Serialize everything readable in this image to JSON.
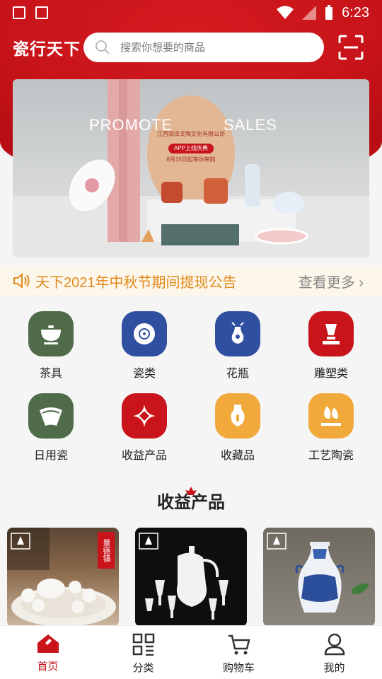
{
  "status_bar": {
    "time": "6:23"
  },
  "header": {
    "brand": "瓷行天下",
    "search_placeholder": "搜索你想要的商品"
  },
  "banner": {
    "headline_left": "PROMOTE",
    "headline_right": "SALES",
    "company": "江西润泽文陶文化有限公司",
    "tag": "APP上线庆典",
    "date_line": "8月15日起等你来购"
  },
  "notice": {
    "text": "天下2021年中秋节期间提现公告",
    "more": "查看更多"
  },
  "categories": [
    {
      "label": "茶具",
      "icon": "tea-set-icon",
      "color": "#4f6b4a"
    },
    {
      "label": "瓷类",
      "icon": "plate-icon",
      "color": "#2f4fa0"
    },
    {
      "label": "花瓶",
      "icon": "vase-icon",
      "color": "#2f4fa0"
    },
    {
      "label": "雕塑类",
      "icon": "sculpture-icon",
      "color": "#c8141a"
    },
    {
      "label": "日用瓷",
      "icon": "fan-icon",
      "color": "#4f6b4a"
    },
    {
      "label": "收益产品",
      "icon": "diamond-icon",
      "color": "#c8141a"
    },
    {
      "label": "收藏品",
      "icon": "jar-icon",
      "color": "#f2a93b"
    },
    {
      "label": "工艺陶瓷",
      "icon": "flame-icon",
      "color": "#f2a93b"
    }
  ],
  "section": {
    "title": "收益产品"
  },
  "products": [
    {
      "name": "tea-set-product",
      "stamp": "景德镇"
    },
    {
      "name": "wine-set-product"
    },
    {
      "name": "blue-white-vase-product"
    }
  ],
  "tabs": [
    {
      "label": "首页",
      "icon": "home-icon",
      "active": true
    },
    {
      "label": "分类",
      "icon": "grid-icon",
      "active": false
    },
    {
      "label": "购物车",
      "icon": "cart-icon",
      "active": false
    },
    {
      "label": "我的",
      "icon": "user-icon",
      "active": false
    }
  ]
}
